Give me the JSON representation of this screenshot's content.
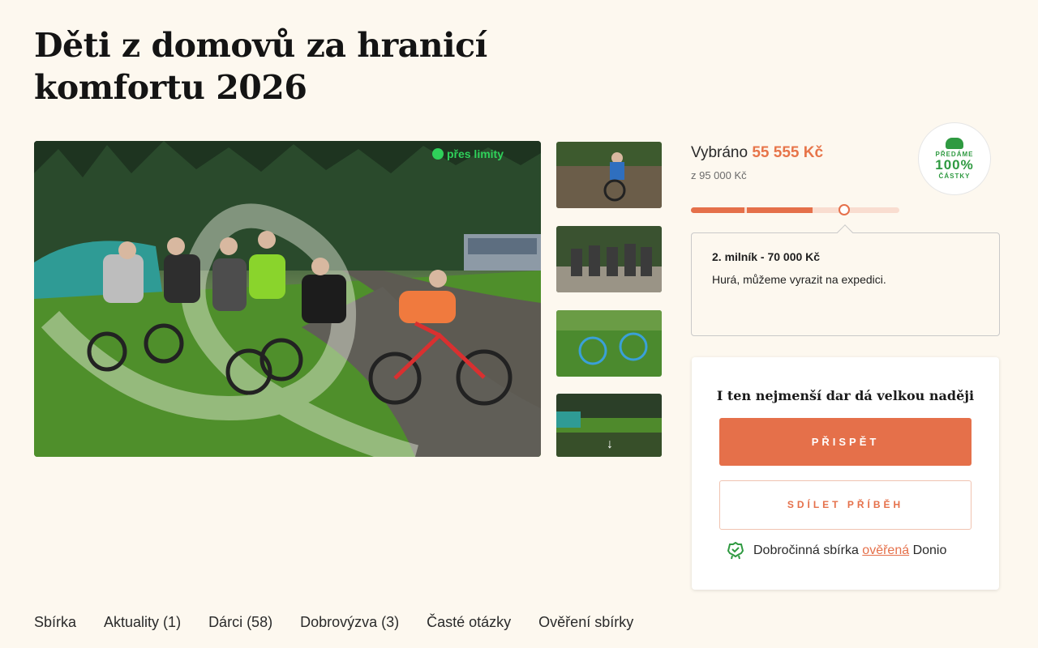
{
  "page": {
    "title": "Děti z domovů za hranicí komfortu 2026"
  },
  "gallery": {
    "brand": "přes limity",
    "more_icon": "arrow-down-icon"
  },
  "progress": {
    "raised_label": "Vybráno",
    "raised_amount": "55 555 Kč",
    "goal": "z 95 000 Kč",
    "fraction": 0.585,
    "badge_top": "PŘEDÁME",
    "badge_value": "100%",
    "badge_bottom": "ČÁSTKY",
    "milestone_title": "2. milník - 70 000 Kč",
    "milestone_text": "Hurá, můžeme vyrazit na expedici."
  },
  "donate": {
    "heading": "I ten nejmenší dar dá velkou naději",
    "donate_label": "PŘISPĚT",
    "share_label": "SDÍLET PŘÍBĚH",
    "verified_prefix": "Dobročinná sbírka",
    "verified_link": "ověřená",
    "verified_suffix": "Donio"
  },
  "tabs": [
    "Sbírka",
    "Aktuality (1)",
    "Dárci (58)",
    "Dobrovýzva (3)",
    "Časté otázky",
    "Ověření sbírky"
  ],
  "colors": {
    "accent": "#e5704a",
    "background": "#fdf8ef",
    "verified_green": "#2f9a41"
  }
}
